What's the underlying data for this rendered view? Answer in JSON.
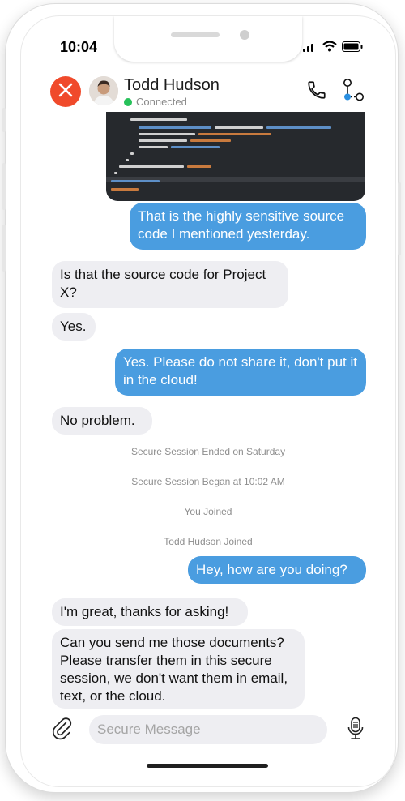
{
  "status_bar": {
    "time": "10:04"
  },
  "header": {
    "contact_name": "Todd Hudson",
    "status": "Connected",
    "status_color": "#27c15a",
    "close_color": "#f04a2b"
  },
  "code_snippet": {
    "lines": [
      "if (host && host.length)",
      "NSMutableDictionary* hostInfo = [NSMutableDictionary dictionary];",
      "[hostInfo setObject:@\"ipv4\" forKey:@\"ip_version\"];",
      "[hostInfo setObject:host forKey:@\"host\"];",
      "[hosts addObject:hostInfo];",
      "}",
      "}",
      "temp_addr = temp_addr->ifa_next;",
      "}",
      "}",
      "freeifaddrs(interfaces);",
      "return hosts;"
    ]
  },
  "messages": [
    {
      "type": "outgoing",
      "text": "That is the highly sensitive source code I mentioned yesterday."
    },
    {
      "type": "incoming",
      "text": "Is that the source code for Project X?"
    },
    {
      "type": "incoming",
      "text": "Yes."
    },
    {
      "type": "outgoing",
      "text": "Yes. Please do not share it, don't put it in the cloud!"
    },
    {
      "type": "incoming",
      "text": "No problem."
    },
    {
      "type": "system",
      "text": "Secure Session Ended on Saturday"
    },
    {
      "type": "system",
      "text": "Secure Session Began at 10:02 AM"
    },
    {
      "type": "system",
      "text": "You Joined"
    },
    {
      "type": "system",
      "text": "Todd Hudson Joined"
    },
    {
      "type": "outgoing",
      "text": "Hey, how are you doing?"
    },
    {
      "type": "incoming",
      "text": "I'm great, thanks for asking!"
    },
    {
      "type": "incoming",
      "text": "Can you send me those documents? Please transfer them in this secure session, we don't want them in email, text, or the cloud."
    }
  ],
  "composer": {
    "placeholder": "Secure Message"
  },
  "colors": {
    "outgoing_bubble": "#4a9de0",
    "incoming_bubble": "#eeeef2",
    "accent": "#2a8fe0"
  },
  "icons": [
    "wifi-icon",
    "battery-icon",
    "signal-icon",
    "close-icon",
    "phone-call-icon",
    "share-connection-icon",
    "paperclip-icon",
    "microphone-icon"
  ]
}
